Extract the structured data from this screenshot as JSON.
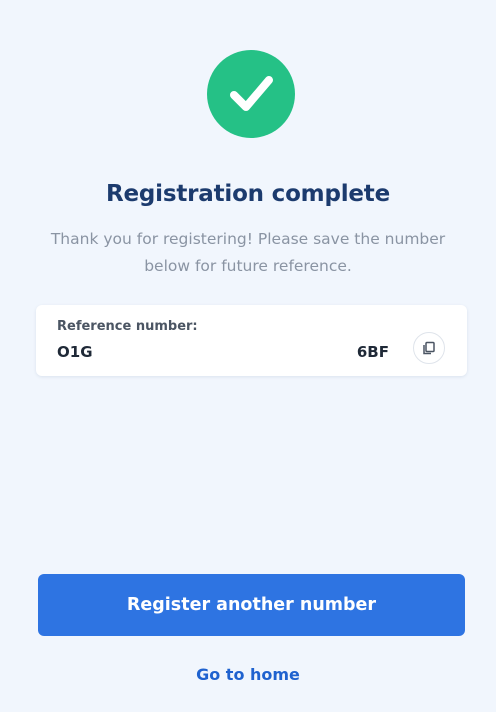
{
  "status": {
    "title": "Registration complete",
    "message": "Thank you for registering! Please save the number below for future reference."
  },
  "reference": {
    "label": "Reference number:",
    "value_start": "O1G",
    "value_end": "6BF",
    "copy_icon": "copy-icon"
  },
  "actions": {
    "primary_label": "Register another number",
    "home_label": "Go to home"
  },
  "colors": {
    "background": "#f1f6fd",
    "success": "#25c186",
    "title": "#1c3b6e",
    "primary": "#2e74e2",
    "link": "#1f62cf"
  }
}
